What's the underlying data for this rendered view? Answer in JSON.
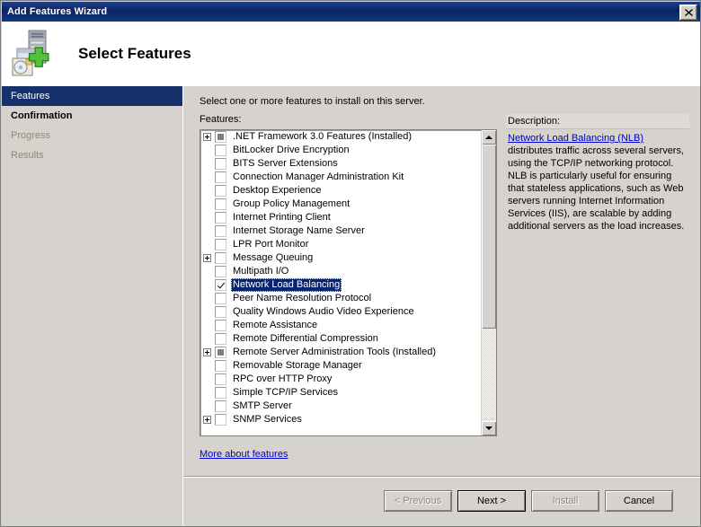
{
  "window": {
    "title": "Add Features Wizard",
    "close_label": "✕"
  },
  "header": {
    "title": "Select Features",
    "icon": "server-add-icon"
  },
  "sidebar": {
    "items": [
      {
        "label": "Features",
        "state": "selected"
      },
      {
        "label": "Confirmation",
        "state": "strong"
      },
      {
        "label": "Progress",
        "state": "dim"
      },
      {
        "label": "Results",
        "state": "dim"
      }
    ]
  },
  "content": {
    "intro": "Select one or more features to install on this server.",
    "features_label": "Features:",
    "more_link": "More about features"
  },
  "features": [
    {
      "label": ".NET Framework 3.0 Features  (Installed)",
      "expander": "plus",
      "check": "filled"
    },
    {
      "label": "BitLocker Drive Encryption",
      "expander": "none",
      "check": "empty"
    },
    {
      "label": "BITS Server Extensions",
      "expander": "none",
      "check": "empty"
    },
    {
      "label": "Connection Manager Administration Kit",
      "expander": "none",
      "check": "empty"
    },
    {
      "label": "Desktop Experience",
      "expander": "none",
      "check": "empty"
    },
    {
      "label": "Group Policy Management",
      "expander": "none",
      "check": "empty"
    },
    {
      "label": "Internet Printing Client",
      "expander": "none",
      "check": "empty"
    },
    {
      "label": "Internet Storage Name Server",
      "expander": "none",
      "check": "empty"
    },
    {
      "label": "LPR Port Monitor",
      "expander": "none",
      "check": "empty"
    },
    {
      "label": "Message Queuing",
      "expander": "plus",
      "check": "empty"
    },
    {
      "label": "Multipath I/O",
      "expander": "none",
      "check": "empty"
    },
    {
      "label": "Network Load Balancing",
      "expander": "none",
      "check": "checked",
      "selected": true
    },
    {
      "label": "Peer Name Resolution Protocol",
      "expander": "none",
      "check": "empty"
    },
    {
      "label": "Quality Windows Audio Video Experience",
      "expander": "none",
      "check": "empty"
    },
    {
      "label": "Remote Assistance",
      "expander": "none",
      "check": "empty"
    },
    {
      "label": "Remote Differential Compression",
      "expander": "none",
      "check": "empty"
    },
    {
      "label": "Remote Server Administration Tools  (Installed)",
      "expander": "plus",
      "check": "filled"
    },
    {
      "label": "Removable Storage Manager",
      "expander": "none",
      "check": "empty"
    },
    {
      "label": "RPC over HTTP Proxy",
      "expander": "none",
      "check": "empty"
    },
    {
      "label": "Simple TCP/IP Services",
      "expander": "none",
      "check": "empty"
    },
    {
      "label": "SMTP Server",
      "expander": "none",
      "check": "empty"
    },
    {
      "label": "SNMP Services",
      "expander": "plus",
      "check": "empty"
    }
  ],
  "description": {
    "header": "Description:",
    "link": "Network Load Balancing (NLB)",
    "body": " distributes traffic across several servers, using the TCP/IP networking protocol. NLB is particularly useful for ensuring that stateless applications, such as Web servers running Internet Information Services (IIS), are scalable by adding additional servers as the load increases."
  },
  "footer": {
    "previous": "< Previous",
    "next": "Next >",
    "install": "Install",
    "cancel": "Cancel"
  },
  "colors": {
    "titlebar": "#0a2464",
    "selection": "#0a246a",
    "face": "#d6d3ce",
    "link": "#0000cc"
  }
}
